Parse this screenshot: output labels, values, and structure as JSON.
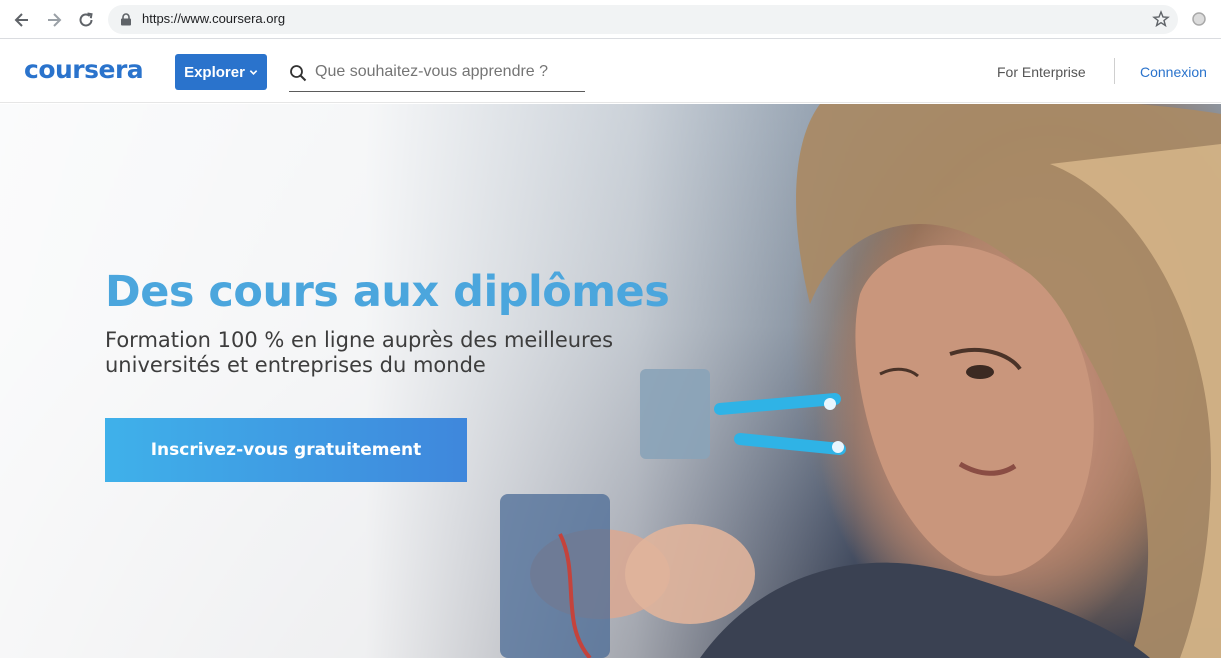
{
  "browser": {
    "url": "https://www.coursera.org"
  },
  "header": {
    "logo_text": "coursera",
    "explore_label": "Explorer",
    "search_placeholder": "Que souhaitez-vous apprendre ?",
    "enterprise_label": "For Enterprise",
    "login_label": "Connexion"
  },
  "hero": {
    "title": "Des cours aux diplômes",
    "subtitle": "Formation 100 % en ligne auprès des meilleures universités et entreprises du monde",
    "cta_label": "Inscrivez-vous gratuitement"
  },
  "colors": {
    "brand_blue": "#2a73cc",
    "title_blue": "#4ba6dd",
    "cta_start": "#3fb1ea",
    "cta_end": "#3f87dc"
  },
  "icons": {
    "back": "arrow-left-icon",
    "forward": "arrow-right-icon",
    "reload": "reload-icon",
    "lock": "lock-icon",
    "bookmark": "star-icon",
    "extension": "circle-icon",
    "search": "search-icon",
    "explore_caret": "chevron-down-icon"
  }
}
